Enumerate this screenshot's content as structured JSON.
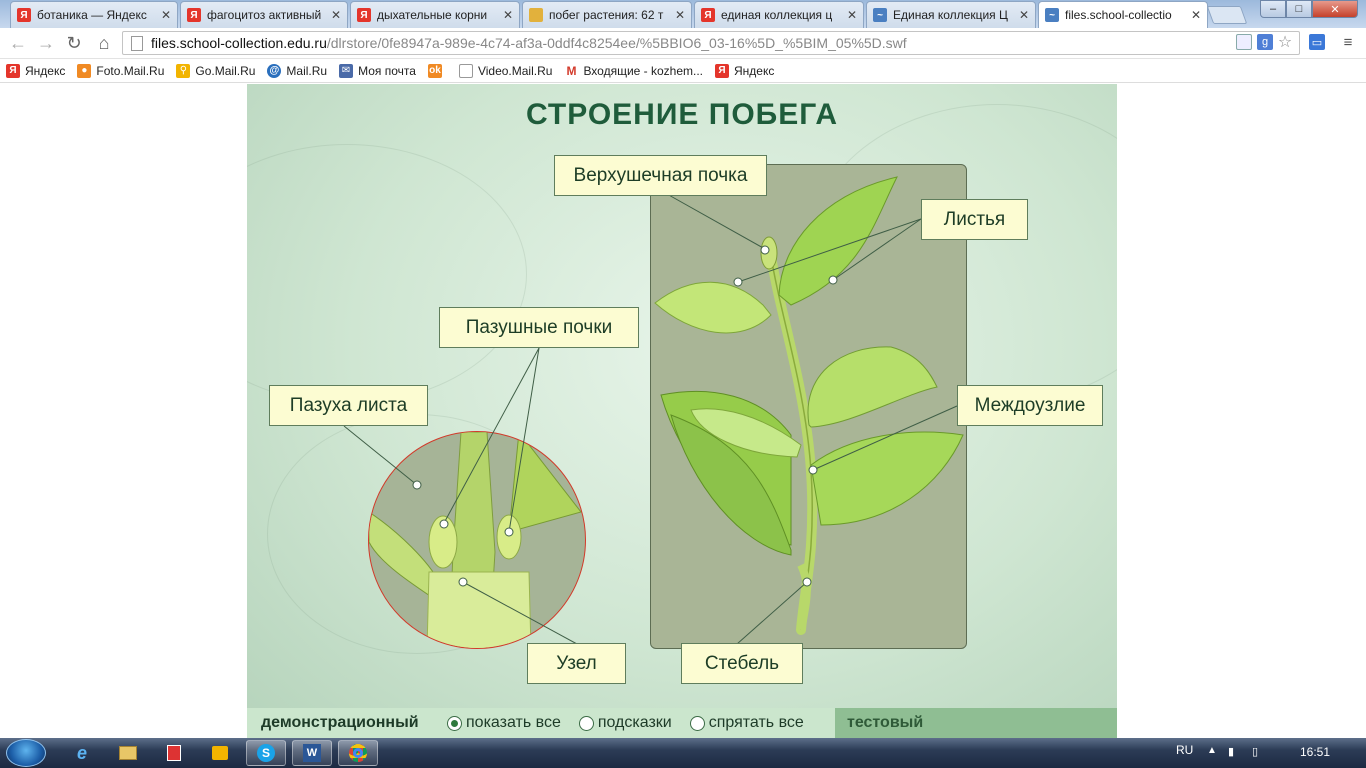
{
  "browser": {
    "tabs": [
      {
        "title": "ботаника — Яндекс",
        "favicon": "yandex-icon",
        "color": "#e4352b",
        "active": false
      },
      {
        "title": "фагоцитоз активный",
        "favicon": "yandex-icon",
        "color": "#e4352b",
        "active": false
      },
      {
        "title": "дыхательные корни",
        "favicon": "yandex-icon",
        "color": "#e4352b",
        "active": false
      },
      {
        "title": "побег растения: 62 т",
        "favicon": "page-icon",
        "color": "#e2b13c",
        "active": false
      },
      {
        "title": "единая коллекция ц",
        "favicon": "yandex-icon",
        "color": "#e4352b",
        "active": false
      },
      {
        "title": "Единая коллекция Ц",
        "favicon": "collection-icon",
        "color": "#4a7fc1",
        "active": false
      },
      {
        "title": "files.school-collectio",
        "favicon": "collection-icon",
        "color": "#4a7fc1",
        "active": true
      }
    ],
    "window_controls": {
      "minimize": "–",
      "maximize": "□",
      "close": "✕"
    },
    "url": {
      "host": "files.school-collection.edu.ru",
      "path": "/dlrstore/0fe8947a-989e-4c74-af3a-0ddf4c8254ee/%5BBIO6_03-16%5D_%5BIM_05%5D.swf"
    },
    "bookmarks": [
      {
        "label": "Яндекс",
        "icon": "yandex-icon",
        "color": "#e4352b"
      },
      {
        "label": "Foto.Mail.Ru",
        "icon": "foto-icon",
        "color": "#f08a24"
      },
      {
        "label": "Go.Mail.Ru",
        "icon": "search-icon",
        "color": "#f2b400"
      },
      {
        "label": "Mail.Ru",
        "icon": "mailru-icon",
        "color": "#2a6fbd"
      },
      {
        "label": "Моя почта",
        "icon": "mail-icon",
        "color": "#4a6aa8"
      },
      {
        "label": "",
        "icon": "odnoklassniki-icon",
        "color": "#f08a24"
      },
      {
        "label": "Video.Mail.Ru",
        "icon": "page-icon",
        "color": "#999999"
      },
      {
        "label": "Входящие - kozhem...",
        "icon": "gmail-icon",
        "color": "#d33b2c"
      },
      {
        "label": "Яндекс",
        "icon": "yandex-icon",
        "color": "#e4352b"
      }
    ]
  },
  "flash": {
    "title": "СТРОЕНИЕ  ПОБЕГА",
    "labels": {
      "apical_bud": "Верхушечная почка",
      "leaves": "Листья",
      "axillary_buds": "Пазушные почки",
      "leaf_axil": "Пазуха листа",
      "internode": "Междоузлие",
      "node": "Узел",
      "stem": "Стебель"
    },
    "controls": {
      "demo_mode": "демонстрационный",
      "show_all": "показать все",
      "hints": "подсказки",
      "hide_all": "спрятать все",
      "test_mode": "тестовый",
      "selected": "show_all"
    }
  },
  "taskbar": {
    "apps": [
      "internet-explorer-icon",
      "folder-icon",
      "media-icon",
      "player-icon",
      "skype-icon",
      "word-icon",
      "chrome-icon"
    ],
    "language": "RU",
    "clock": "16:51"
  }
}
